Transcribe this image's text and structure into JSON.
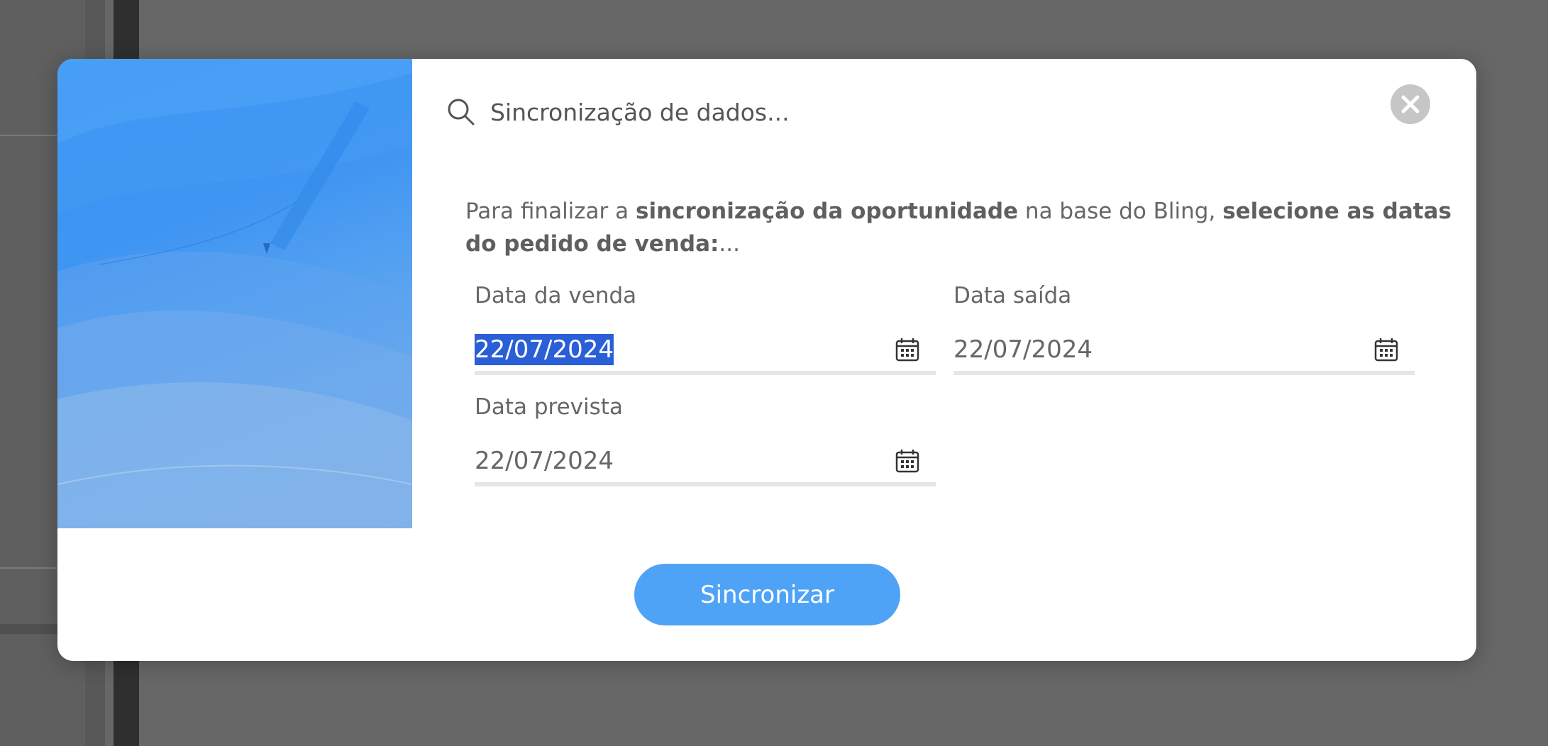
{
  "modal": {
    "title": "Sincronização de dados...",
    "instruction": {
      "part1": "Para finalizar a ",
      "bold1": "sincronização da oportunidade",
      "part2": " na base do Bling, ",
      "bold2": "selecione as datas do pedido de venda:",
      "part3": "..."
    },
    "fields": {
      "data_venda": {
        "label": "Data da venda",
        "value": "22/07/2024"
      },
      "data_saida": {
        "label": "Data saída",
        "value": "22/07/2024"
      },
      "data_prevista": {
        "label": "Data prevista",
        "value": "22/07/2024"
      }
    },
    "sync_button": "Sincronizar",
    "icons": {
      "search": "search-icon",
      "close": "close-icon",
      "calendar": "calendar-icon"
    },
    "colors": {
      "accent": "#4fa3f7",
      "hero": "#3f95f2",
      "selection": "#2a5fd8",
      "close_bg": "#c6c6c6"
    }
  }
}
